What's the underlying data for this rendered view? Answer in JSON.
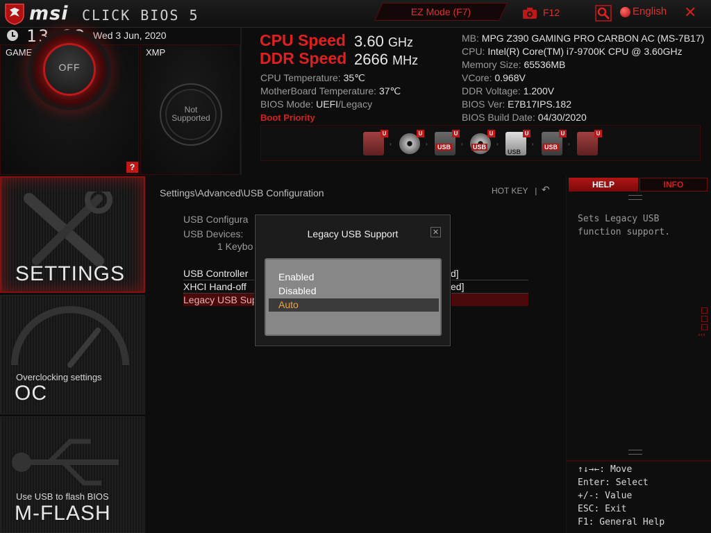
{
  "header": {
    "brand": "msi",
    "product": "CLICK BIOS 5",
    "ez_mode": "EZ Mode (F7)",
    "screenshot_key": "F12",
    "language": "English",
    "close": "✕"
  },
  "status": {
    "time": "13:22",
    "date": "Wed  3 Jun, 2020"
  },
  "game_boost": {
    "title": "GAME BOOST",
    "state": "OFF",
    "help": "?"
  },
  "xmp": {
    "title": "XMP",
    "state_line1": "Not",
    "state_line2": "Supported"
  },
  "speeds": {
    "cpu_label": "CPU Speed",
    "cpu_value": "3.60",
    "cpu_unit": "GHz",
    "ddr_label": "DDR Speed",
    "ddr_value": "2666",
    "ddr_unit": "MHz"
  },
  "sysinfo_left": [
    {
      "label": "CPU Temperature: ",
      "value": "35℃"
    },
    {
      "label": "MotherBoard Temperature: ",
      "value": "37℃"
    },
    {
      "label": "BIOS Mode: ",
      "value": "UEFI",
      "suffix": "/Legacy"
    }
  ],
  "sysinfo_right": [
    {
      "label": "MB: ",
      "value": "MPG Z390 GAMING PRO CARBON AC (MS-7B17)"
    },
    {
      "label": "CPU: ",
      "value": "Intel(R) Core(TM) i7-9700K CPU @ 3.60GHz"
    },
    {
      "label": "Memory Size: ",
      "value": "65536MB"
    },
    {
      "label": "VCore: ",
      "value": "0.968V"
    },
    {
      "label": "DDR Voltage: ",
      "value": "1.200V"
    },
    {
      "label": "BIOS Ver: ",
      "value": "E7B17IPS.182"
    },
    {
      "label": "BIOS Build Date: ",
      "value": "04/30/2020"
    }
  ],
  "boot_priority": {
    "label": "Boot Priority",
    "badge": "U",
    "usb_text": "USB",
    "devices": [
      "hdd-icon",
      "optical-disc-icon",
      "usb-hdd-icon",
      "usb-optical-icon",
      "usb-key-icon",
      "usb-floppy-icon",
      "network-icon"
    ]
  },
  "nav": {
    "settings": "SETTINGS",
    "oc_caption": "Overclocking settings",
    "oc": "OC",
    "mflash_caption": "Use USB to flash BIOS",
    "mflash": "M-FLASH"
  },
  "main": {
    "breadcrumb": "Settings\\Advanced\\USB Configuration",
    "hotkey": "HOT KEY",
    "hotkey_sep": "|",
    "section_title": "USB Configura",
    "devices_label": "USB Devices:",
    "devices_value": "1 Keybo",
    "items": [
      {
        "label": "USB Controller",
        "value": "d]"
      },
      {
        "label": "XHCI Hand-off",
        "value": "ed]"
      },
      {
        "label": "Legacy USB Supp",
        "value": ""
      }
    ]
  },
  "dialog": {
    "title": "Legacy USB Support",
    "close": "✕",
    "options": [
      "Enabled",
      "Disabled",
      "Auto"
    ],
    "selected": "Auto"
  },
  "help": {
    "tab_help": "HELP",
    "tab_info": "INFO",
    "text_line1": "Sets Legacy USB",
    "text_line2": "function support.",
    "keys": [
      "↑↓→←: Move",
      "Enter: Select",
      "+/-: Value",
      "ESC: Exit",
      "F1: General Help"
    ]
  },
  "colors": {
    "accent": "#e02020",
    "selected_text": "#f0a040",
    "background": "#0d0d0d"
  }
}
